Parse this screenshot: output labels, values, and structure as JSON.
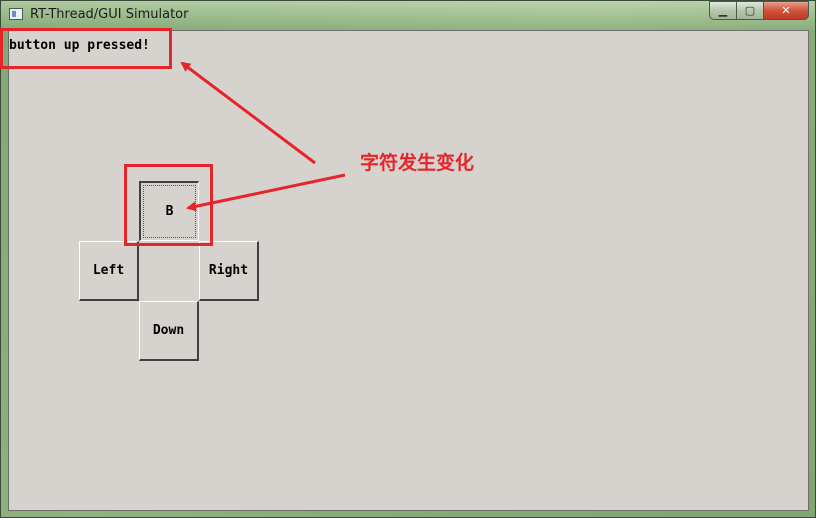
{
  "window": {
    "title": "RT-Thread/GUI Simulator",
    "minimize_glyph": "▁",
    "maximize_glyph": "▢",
    "close_glyph": "✕"
  },
  "status": {
    "message": "button up pressed!"
  },
  "buttons": {
    "up_label": "B",
    "left_label": "Left",
    "right_label": "Right",
    "down_label": "Down"
  },
  "annotation": {
    "text": "字符发生变化",
    "color": "#e6252b"
  },
  "colors": {
    "client_background": "#d6d3ce",
    "annotation_red": "#e6252b"
  }
}
